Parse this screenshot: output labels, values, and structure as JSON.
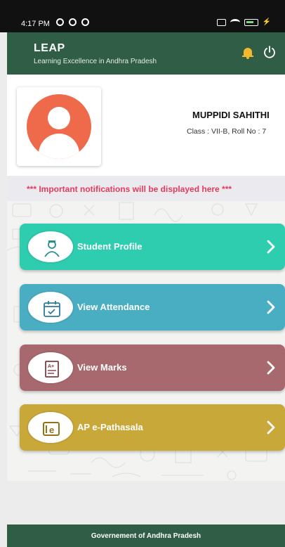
{
  "status_bar": {
    "time": "4:17 PM"
  },
  "header": {
    "title": "LEAP",
    "subtitle": "Learning Excellence in Andhra Pradesh",
    "notification_icon": "bell-icon",
    "logout_icon": "power-icon"
  },
  "profile": {
    "name": "MUPPIDI SAHITHI",
    "class_info": "Class : VII-B, Roll No : 7"
  },
  "notice": {
    "text": "*** Important notifications will be displayed here ***"
  },
  "menu": [
    {
      "label": "Student Profile",
      "icon": "student-profile-icon",
      "color": "#2ecdb0"
    },
    {
      "label": "View Attendance",
      "icon": "calendar-check-icon",
      "color": "#4aaec2"
    },
    {
      "label": "View Marks",
      "icon": "marks-report-icon",
      "color": "#a8696e"
    },
    {
      "label": "AP e-Pathasala",
      "icon": "book-icon",
      "color": "#c9a83a"
    }
  ],
  "footer": {
    "text": "Governement of Andhra Pradesh"
  },
  "colors": {
    "header": "#2f5d46",
    "notice_text": "#e63b5e",
    "avatar": "#ef6a4a",
    "bell": "#f2b82e"
  }
}
